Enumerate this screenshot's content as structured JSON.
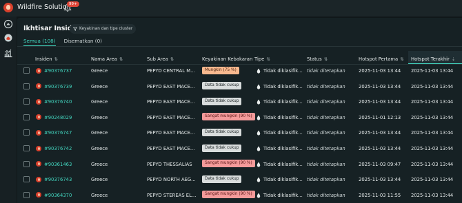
{
  "app": {
    "title": "Wildfire Solution",
    "notification_count": "99+"
  },
  "panel": {
    "title": "Ikhtisar Insiden",
    "filter_label": "Keyakinan dan tipe cluster"
  },
  "tabs": [
    {
      "label": "Semua (108)",
      "active": true
    },
    {
      "label": "Disematkan (0)",
      "active": false
    }
  ],
  "columns": [
    "Insiden",
    "Nama Area",
    "Sub Area",
    "Keyakinan Kebakaran",
    "Tipe",
    "Status",
    "Hotspot Pertama",
    "Hotspot Terakhir"
  ],
  "rows": [
    {
      "id": "#90376737",
      "area": "Greece",
      "sub_area": "PEPYD CENTRAL M...",
      "confidence": "Mungkin (75 %)",
      "level": "orange",
      "type": "Tidak diklasifik...",
      "status": "tidak ditetapkan",
      "first": "2025-11-03 13:44",
      "last": "2025-11-03 13:44"
    },
    {
      "id": "#90376739",
      "area": "Greece",
      "sub_area": "PEPYD EAST MACE...",
      "confidence": "Data tidak cukup",
      "level": "gray",
      "type": "Tidak diklasifik...",
      "status": "tidak ditetapkan",
      "first": "2025-11-03 13:44",
      "last": "2025-11-03 13:44"
    },
    {
      "id": "#90376740",
      "area": "Greece",
      "sub_area": "PEPYD EAST MACE...",
      "confidence": "Data tidak cukup",
      "level": "gray",
      "type": "Tidak diklasifik...",
      "status": "tidak ditetapkan",
      "first": "2025-11-03 13:44",
      "last": "2025-11-03 13:44"
    },
    {
      "id": "#90248029",
      "area": "Greece",
      "sub_area": "PEPYD EAST MACE...",
      "confidence": "Sangat mungkin (90 %)",
      "level": "red",
      "type": "Tidak diklasifik...",
      "status": "tidak ditetapkan",
      "first": "2025-11-01 12:13",
      "last": "2025-11-03 13:44"
    },
    {
      "id": "#90376747",
      "area": "Greece",
      "sub_area": "PEPYD EAST MACE...",
      "confidence": "Data tidak cukup",
      "level": "gray",
      "type": "Tidak diklasifik...",
      "status": "tidak ditetapkan",
      "first": "2025-11-03 13:44",
      "last": "2025-11-03 13:44"
    },
    {
      "id": "#90376742",
      "area": "Greece",
      "sub_area": "PEPYD EAST MACE...",
      "confidence": "Data tidak cukup",
      "level": "gray",
      "type": "Tidak diklasifik...",
      "status": "tidak ditetapkan",
      "first": "2025-11-03 13:44",
      "last": "2025-11-03 13:44"
    },
    {
      "id": "#90361463",
      "area": "Greece",
      "sub_area": "PEPYD THESSALIAS",
      "confidence": "Sangat mungkin (90 %)",
      "level": "red",
      "type": "Tidak diklasifik...",
      "status": "tidak ditetapkan",
      "first": "2025-11-03 09:47",
      "last": "2025-11-03 13:44"
    },
    {
      "id": "#90376743",
      "area": "Greece",
      "sub_area": "PEPYD NORTH AEG...",
      "confidence": "Data tidak cukup",
      "level": "gray",
      "type": "Tidak diklasifik...",
      "status": "tidak ditetapkan",
      "first": "2025-11-03 13:44",
      "last": "2025-11-03 13:44"
    },
    {
      "id": "#90364370",
      "area": "Greece",
      "sub_area": "PEPYD STEREAS EL...",
      "confidence": "Sangat mungkin (90 %)",
      "level": "red",
      "type": "Tidak diklasifik...",
      "status": "tidak ditetapkan",
      "first": "2025-11-03 11:55",
      "last": "2025-11-03 13:44"
    }
  ],
  "colors": {
    "accent": "#43d7c0",
    "incident_icon": "#d9412c",
    "badge_gray": "#d9dddd",
    "badge_orange": "#f8b98f",
    "badge_red": "#f49a9a"
  },
  "icons": {
    "logo": "flame-logo-icon",
    "bell": "bell-icon",
    "filter": "filter-icon",
    "sort": "sort-arrows-icon",
    "incident": "fire-incident-icon",
    "type": "flame-drop-icon",
    "rail": [
      "incident-map-icon",
      "layers-icon",
      "analytics-icon"
    ]
  }
}
